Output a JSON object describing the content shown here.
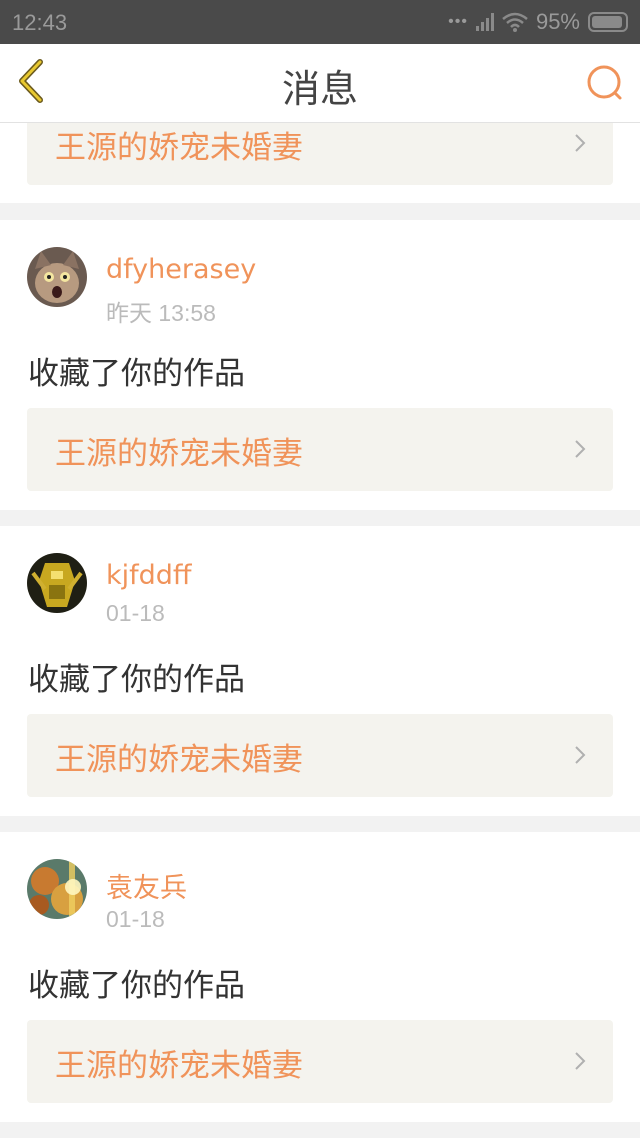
{
  "status_bar": {
    "time": "12:43",
    "battery": "95%"
  },
  "header": {
    "title": "消息"
  },
  "messages": [
    {
      "work_title": "王源的娇宠未婚妻"
    },
    {
      "username": "dfyherasey",
      "time": "昨天 13:58",
      "action": "收藏了你的作品",
      "work_title": "王源的娇宠未婚妻",
      "avatar": "cat-avatar"
    },
    {
      "username": "kjfddff",
      "time": "01-18",
      "action": "收藏了你的作品",
      "work_title": "王源的娇宠未婚妻",
      "avatar": "robot-avatar"
    },
    {
      "username": "袁友兵",
      "time": "01-18",
      "action": "收藏了你的作品",
      "work_title": "王源的娇宠未婚妻",
      "avatar": "autumn-avatar"
    }
  ],
  "colors": {
    "accent": "#f0935a",
    "link_bg": "#f4f3ee",
    "status_bg": "#4a4a4a"
  }
}
